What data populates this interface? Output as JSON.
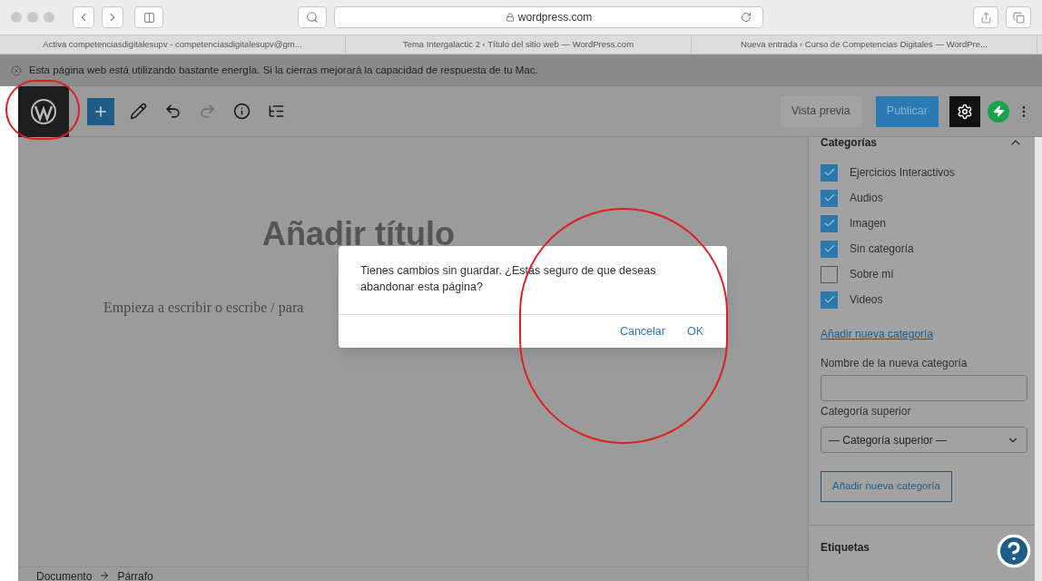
{
  "browser": {
    "address": "wordpress.com",
    "tabs": [
      {
        "label": "Activa competenciasdigitalesupv - competenciasdigitalesupv@gm..."
      },
      {
        "label": "Tema Intergalactic 2 ‹ Título del sitio web — WordPress.com"
      },
      {
        "label": "Nueva entrada ‹ Curso de Competencias Digitales — WordPre..."
      }
    ],
    "energy_notice": "Esta página web está utilizando bastante energía. Si la cierras mejorará la capacidad de respuesta de tu Mac."
  },
  "toolbar": {
    "tools": [
      {
        "kind": "add",
        "disabled": false
      },
      {
        "kind": "edit",
        "disabled": false
      },
      {
        "kind": "undo",
        "disabled": false
      },
      {
        "kind": "redo",
        "disabled": true
      },
      {
        "kind": "info",
        "disabled": false
      },
      {
        "kind": "outline",
        "disabled": false
      }
    ],
    "preview": "Vista previa",
    "publish": "Publicar",
    "settings_active": true
  },
  "editor": {
    "title_placeholder": "Añadir título",
    "body_placeholder": "Empieza a escribir o escribe / para"
  },
  "sidebar": {
    "categories": {
      "title": "Categorías",
      "expanded": true,
      "items": [
        {
          "label": "Ejercicios Interactivos",
          "checked": true
        },
        {
          "label": "Audios",
          "checked": true
        },
        {
          "label": "Imagen",
          "checked": true
        },
        {
          "label": "Sin categoría",
          "checked": true
        },
        {
          "label": "Sobre mí",
          "checked": false
        },
        {
          "label": "Videos",
          "checked": true
        }
      ],
      "add_link": "Añadir nueva categoría",
      "new_name_label": "Nombre de la nueva categoría",
      "parent_label": "Categoría superior",
      "parent_select": "— Categoría superior —",
      "add_button": "Añadir nueva categoría"
    },
    "tags_title": "Etiquetas"
  },
  "breadcrumb": [
    "Documento",
    "Párrafo"
  ],
  "dialog": {
    "message": "Tienes cambios sin guardar. ¿Estás seguro de que deseas abandonar esta página?",
    "buttons": [
      "Cancelar",
      "OK"
    ]
  }
}
